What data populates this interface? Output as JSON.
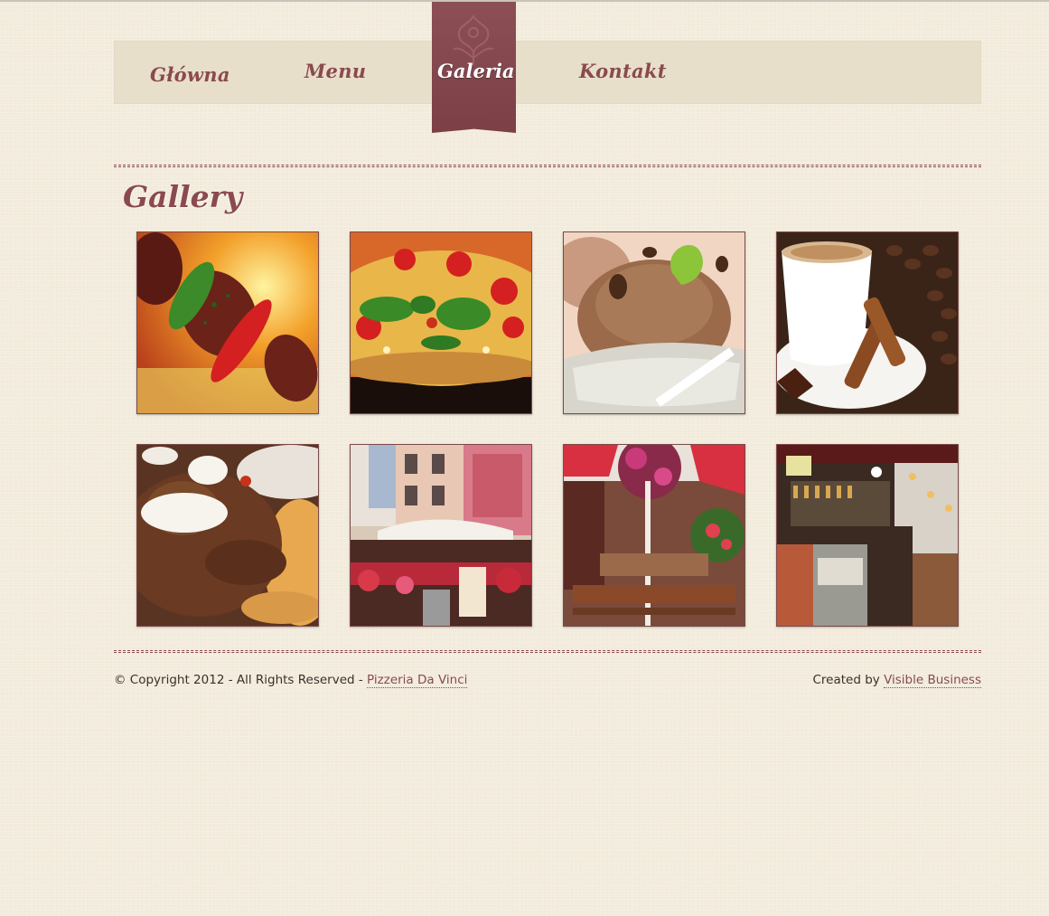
{
  "nav": {
    "items": [
      {
        "label": "Główna"
      },
      {
        "label": "Menu"
      },
      {
        "label": "Galeria",
        "active": true
      },
      {
        "label": "Kontakt"
      }
    ]
  },
  "main": {
    "title": "Gallery"
  },
  "gallery": {
    "images": [
      {
        "subject": "grilled-kebab-skewer"
      },
      {
        "subject": "pizza"
      },
      {
        "subject": "chocolate-ice-cream"
      },
      {
        "subject": "coffee-cinnamon"
      },
      {
        "subject": "gyros-meat-with-sauce"
      },
      {
        "subject": "restaurant-exterior-street"
      },
      {
        "subject": "outdoor-terrace-seating"
      },
      {
        "subject": "bar-interior"
      }
    ]
  },
  "footer": {
    "copyright_text": "© Copyright 2012 - All Rights Reserved - ",
    "brand_link": "Pizzeria Da Vinci",
    "created_text": "Created by ",
    "creator_link": "Visible Business"
  },
  "colors": {
    "background": "#f2ebdc",
    "nav_bar": "#e8dfca",
    "accent": "#8a4a4f",
    "ribbon": "#7b3f45"
  }
}
